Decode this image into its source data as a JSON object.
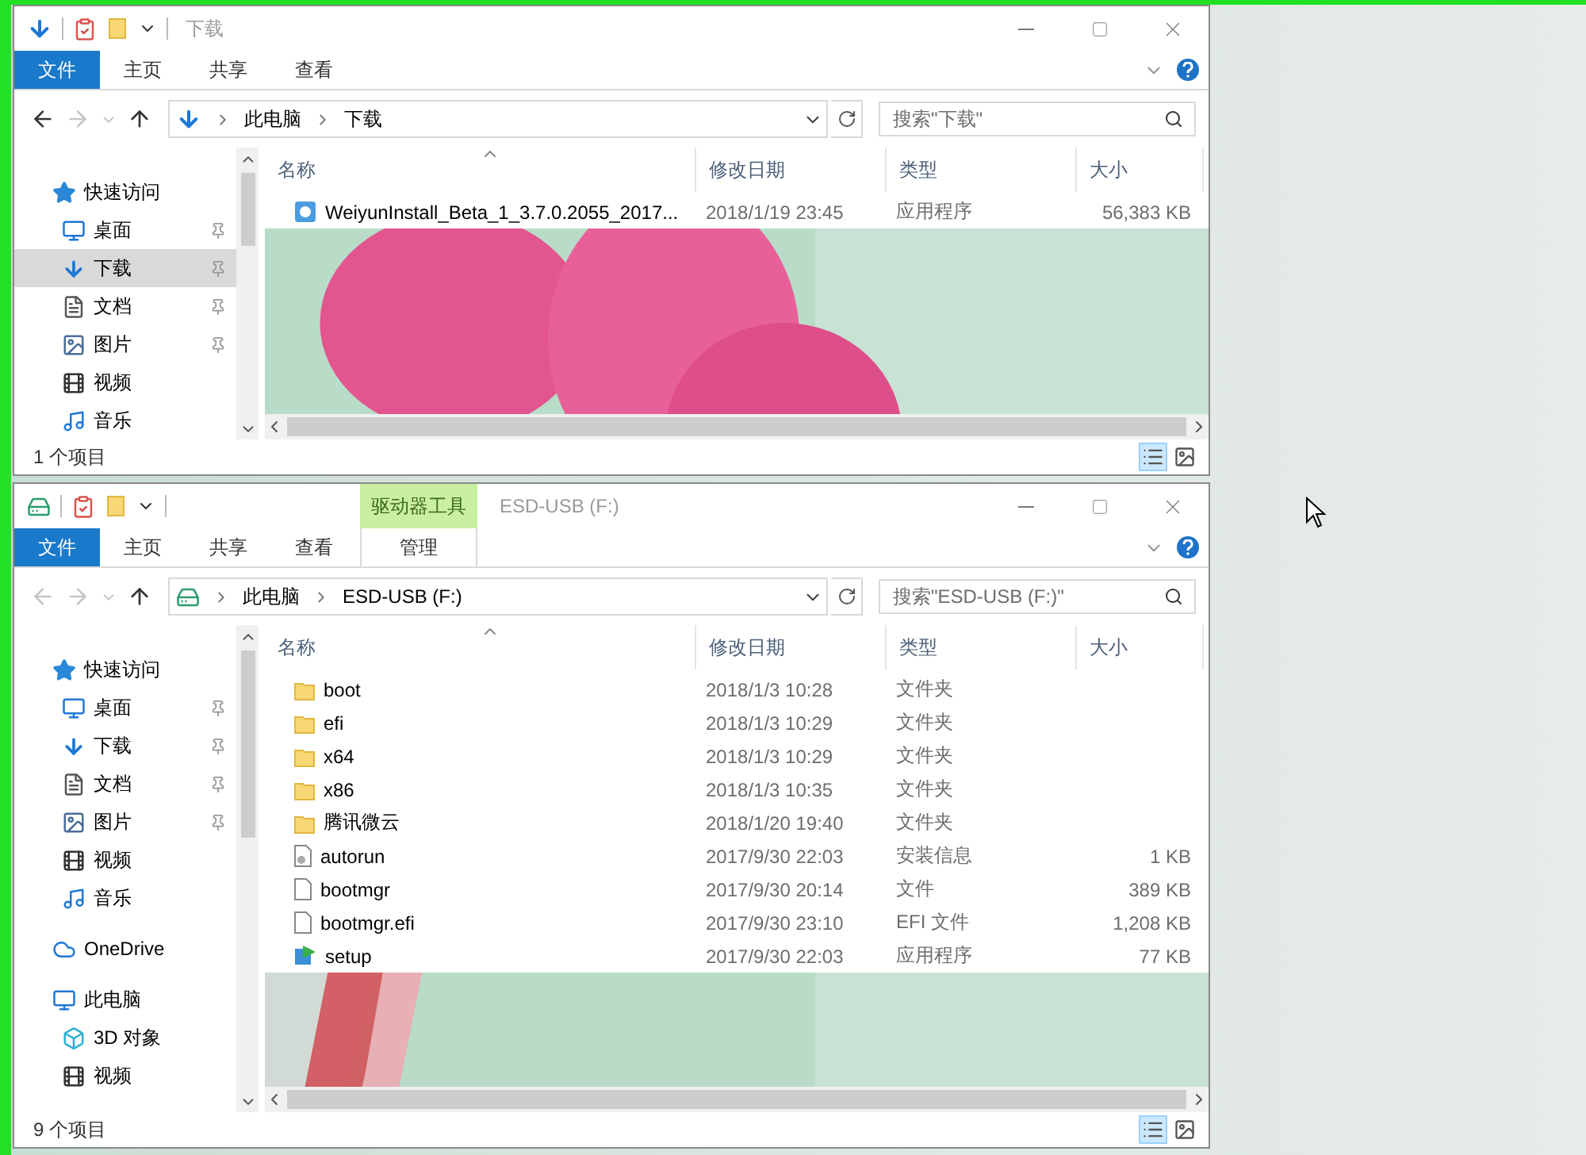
{
  "windows": [
    {
      "title": "下载",
      "location": {
        "kind": "download"
      },
      "ribbon_tabs": [
        {
          "label": "文件",
          "kind": "file"
        },
        {
          "label": "主页",
          "kind": "tab"
        },
        {
          "label": "共享",
          "kind": "tab"
        },
        {
          "label": "查看",
          "kind": "tab"
        }
      ],
      "nav_buttons": [
        {
          "kind": "back",
          "disabled": false
        },
        {
          "kind": "forward",
          "disabled": true
        },
        {
          "kind": "recent",
          "disabled": true
        },
        {
          "kind": "up",
          "disabled": false
        }
      ],
      "breadcrumbs": [
        "此电脑",
        "下载"
      ],
      "search": {
        "placeholder": "搜索\"下载\""
      },
      "nav_pane": [
        {
          "label": "快速访问",
          "kind": "quick",
          "selected": false,
          "children": [
            {
              "label": "桌面",
              "kind": "desktop",
              "pinned": true,
              "selected": false
            },
            {
              "label": "下载",
              "kind": "download",
              "pinned": true,
              "selected": true
            },
            {
              "label": "文档",
              "kind": "documents",
              "pinned": true,
              "selected": false
            },
            {
              "label": "图片",
              "kind": "pictures",
              "pinned": true,
              "selected": false
            },
            {
              "label": "视频",
              "kind": "videos",
              "pinned": false,
              "selected": false
            },
            {
              "label": "音乐",
              "kind": "music",
              "pinned": false,
              "selected": false
            }
          ]
        }
      ],
      "columns": [
        {
          "label": "名称",
          "sorted": true
        },
        {
          "label": "修改日期",
          "sorted": false
        },
        {
          "label": "类型",
          "sorted": false
        },
        {
          "label": "大小",
          "sorted": false
        }
      ],
      "files": [
        {
          "name": "WeiyunInstall_Beta_1_3.7.0.2055_2017...",
          "modified": "2018/1/19 23:45",
          "type": "应用程序",
          "size": "56,383 KB",
          "kind": "app"
        }
      ],
      "status": "1 个项目",
      "views": [
        {
          "kind": "details",
          "selected": true
        },
        {
          "kind": "large-icons",
          "selected": false
        }
      ]
    },
    {
      "title": "ESD-USB (F:)",
      "location": {
        "kind": "drive"
      },
      "ribbon_tabs": [
        {
          "label": "文件",
          "kind": "file"
        },
        {
          "label": "主页",
          "kind": "tab"
        },
        {
          "label": "共享",
          "kind": "tab"
        },
        {
          "label": "查看",
          "kind": "tab"
        },
        {
          "label": "管理",
          "kind": "tab",
          "context": "驱动器工具"
        }
      ],
      "nav_buttons": [
        {
          "kind": "back",
          "disabled": true
        },
        {
          "kind": "forward",
          "disabled": true
        },
        {
          "kind": "recent",
          "disabled": true
        },
        {
          "kind": "up",
          "disabled": false
        }
      ],
      "breadcrumbs": [
        "此电脑",
        "ESD-USB (F:)"
      ],
      "search": {
        "placeholder": "搜索\"ESD-USB (F:)\""
      },
      "nav_pane": [
        {
          "label": "快速访问",
          "kind": "quick",
          "selected": false,
          "children": [
            {
              "label": "桌面",
              "kind": "desktop",
              "pinned": true,
              "selected": false
            },
            {
              "label": "下载",
              "kind": "download",
              "pinned": true,
              "selected": false
            },
            {
              "label": "文档",
              "kind": "documents",
              "pinned": true,
              "selected": false
            },
            {
              "label": "图片",
              "kind": "pictures",
              "pinned": true,
              "selected": false
            },
            {
              "label": "视频",
              "kind": "videos",
              "pinned": false,
              "selected": false
            },
            {
              "label": "音乐",
              "kind": "music",
              "pinned": false,
              "selected": false
            }
          ]
        },
        {
          "label": "OneDrive",
          "kind": "onedrive",
          "selected": false
        },
        {
          "label": "此电脑",
          "kind": "pc",
          "selected": false,
          "children": [
            {
              "label": "3D 对象",
              "kind": "objects",
              "pinned": false,
              "selected": false
            },
            {
              "label": "视频",
              "kind": "videos",
              "pinned": false,
              "selected": false
            }
          ]
        }
      ],
      "columns": [
        {
          "label": "名称",
          "sorted": true
        },
        {
          "label": "修改日期",
          "sorted": false
        },
        {
          "label": "类型",
          "sorted": false
        },
        {
          "label": "大小",
          "sorted": false
        }
      ],
      "files": [
        {
          "name": "boot",
          "modified": "2018/1/3 10:28",
          "type": "文件夹",
          "kind": "folder"
        },
        {
          "name": "efi",
          "modified": "2018/1/3 10:29",
          "type": "文件夹",
          "kind": "folder"
        },
        {
          "name": "x64",
          "modified": "2018/1/3 10:29",
          "type": "文件夹",
          "kind": "folder"
        },
        {
          "name": "x86",
          "modified": "2018/1/3 10:35",
          "type": "文件夹",
          "kind": "folder"
        },
        {
          "name": "腾讯微云",
          "modified": "2018/1/20 19:40",
          "type": "文件夹",
          "kind": "folder"
        },
        {
          "name": "autorun",
          "modified": "2017/9/30 22:03",
          "type": "安装信息",
          "size": "1 KB",
          "kind": "settings-file"
        },
        {
          "name": "bootmgr",
          "modified": "2017/9/30 20:14",
          "type": "文件",
          "size": "389 KB",
          "kind": "file"
        },
        {
          "name": "bootmgr.efi",
          "modified": "2017/9/30 23:10",
          "type": "EFI 文件",
          "size": "1,208 KB",
          "kind": "file"
        },
        {
          "name": "setup",
          "modified": "2017/9/30 22:03",
          "type": "应用程序",
          "size": "77 KB",
          "kind": "setup"
        }
      ],
      "status": "9 个项目",
      "views": [
        {
          "kind": "details",
          "selected": true
        },
        {
          "kind": "large-icons",
          "selected": false
        }
      ]
    }
  ]
}
